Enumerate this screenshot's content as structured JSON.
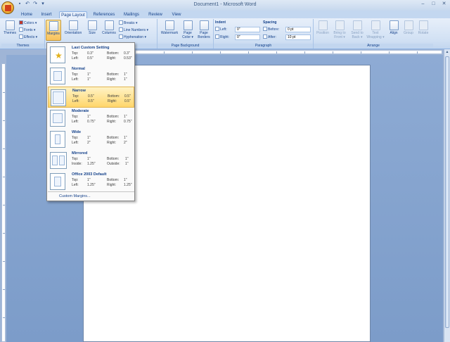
{
  "window": {
    "title": "Document1 - Microsoft Word",
    "controls": [
      "–",
      "□",
      "✕"
    ]
  },
  "quick_access": [
    "save-icon",
    "undo-icon",
    "redo-icon",
    "customize-icon"
  ],
  "tabs": [
    "Home",
    "Insert",
    "Page Layout",
    "References",
    "Mailings",
    "Review",
    "View"
  ],
  "active_tab": "Page Layout",
  "ribbon": {
    "themes": {
      "themes": "Themes",
      "colors": "Colors ▾",
      "fonts": "Fonts ▾",
      "effects": "Effects ▾",
      "group": "Themes"
    },
    "page_setup": {
      "margins": "Margins",
      "orientation": "Orientation",
      "size": "Size",
      "columns": "Columns",
      "breaks": "Breaks ▾",
      "line_numbers": "Line Numbers ▾",
      "hyphenation": "Hyphenation ▾"
    },
    "page_background": {
      "watermark": "Watermark",
      "page_color_1": "Page",
      "page_color_2": "Color ▾",
      "page_borders_1": "Page",
      "page_borders_2": "Borders",
      "group": "Page Background"
    },
    "paragraph": {
      "indent": "Indent",
      "spacing": "Spacing",
      "left_label": "Left:",
      "left_value": "0\"",
      "right_label": "Right:",
      "right_value": "0\"",
      "before_label": "Before:",
      "before_value": "0 pt",
      "after_label": "After:",
      "after_value": "10 pt",
      "group": "Paragraph"
    },
    "arrange": {
      "position": "Position",
      "bring_1": "Bring to",
      "bring_2": "Front ▾",
      "send_1": "Send to",
      "send_2": "Back ▾",
      "text_1": "Text",
      "text_2": "Wrapping ▾",
      "align": "Align",
      "group_btn": "Group",
      "rotate": "Rotate",
      "group": "Arrange"
    }
  },
  "margins_menu": {
    "options": [
      {
        "name": "Last Custom Setting",
        "l1": "Top:",
        "v1": "0.3\"",
        "l2": "Bottom:",
        "v2": "0.3\"",
        "l3": "Left:",
        "v3": "0.5\"",
        "l4": "Right:",
        "v4": "0.53\""
      },
      {
        "name": "Normal",
        "l1": "Top:",
        "v1": "1\"",
        "l2": "Bottom:",
        "v2": "1\"",
        "l3": "Left:",
        "v3": "1\"",
        "l4": "Right:",
        "v4": "1\""
      },
      {
        "name": "Narrow",
        "l1": "Top:",
        "v1": "0.5\"",
        "l2": "Bottom:",
        "v2": "0.5\"",
        "l3": "Left:",
        "v3": "0.5\"",
        "l4": "Right:",
        "v4": "0.5\""
      },
      {
        "name": "Moderate",
        "l1": "Top:",
        "v1": "1\"",
        "l2": "Bottom:",
        "v2": "1\"",
        "l3": "Left:",
        "v3": "0.75\"",
        "l4": "Right:",
        "v4": "0.75\""
      },
      {
        "name": "Wide",
        "l1": "Top:",
        "v1": "1\"",
        "l2": "Bottom:",
        "v2": "1\"",
        "l3": "Left:",
        "v3": "2\"",
        "l4": "Right:",
        "v4": "2\""
      },
      {
        "name": "Mirrored",
        "l1": "Top:",
        "v1": "1\"",
        "l2": "Bottom:",
        "v2": "1\"",
        "l3": "Inside:",
        "v3": "1.25\"",
        "l4": "Outside:",
        "v4": "1\""
      },
      {
        "name": "Office 2003 Default",
        "l1": "Top:",
        "v1": "1\"",
        "l2": "Bottom:",
        "v2": "1\"",
        "l3": "Left:",
        "v3": "1.25\"",
        "l4": "Right:",
        "v4": "1.25\""
      }
    ],
    "highlighted": "Narrow",
    "custom": "Custom Margins..."
  }
}
